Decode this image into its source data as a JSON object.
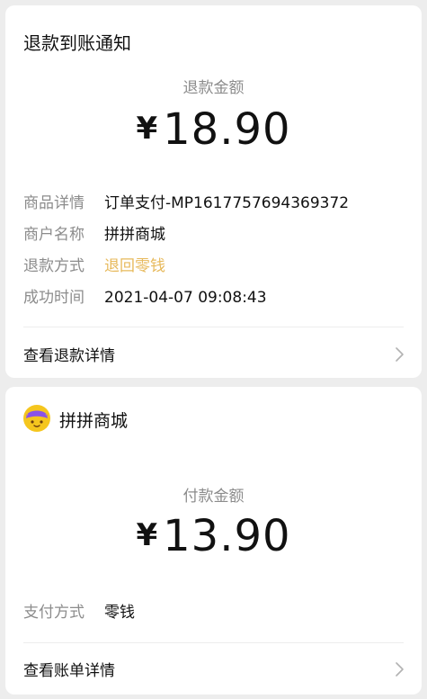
{
  "refund_card": {
    "title": "退款到账通知",
    "amount_label": "退款金额",
    "currency": "¥",
    "amount": "18.90",
    "fields": [
      {
        "label": "商品详情",
        "value": "订单支付-MP1617757694369372"
      },
      {
        "label": "商户名称",
        "value": "拼拼商城"
      },
      {
        "label": "退款方式",
        "value": "退回零钱"
      },
      {
        "label": "成功时间",
        "value": "2021-04-07 09:08:43"
      }
    ],
    "link_label": "查看退款详情"
  },
  "payment_card": {
    "merchant": "拼拼商城",
    "amount_label": "付款金额",
    "currency": "¥",
    "amount": "13.90",
    "method_label": "支付方式",
    "method_value": "零钱",
    "link_label": "查看账单详情"
  },
  "colors": {
    "accent": "#e7b95b",
    "muted": "#8c8c8c",
    "background": "#ededed",
    "avatar": "#8a52e8"
  },
  "icons": [
    "chevron-right-icon",
    "merchant-avatar-icon"
  ]
}
